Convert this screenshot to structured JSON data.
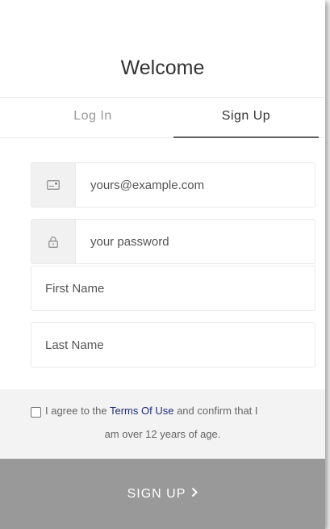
{
  "header": {
    "title": "Welcome"
  },
  "tabs": [
    {
      "label": "Log In",
      "active": false
    },
    {
      "label": "Sign Up",
      "active": true
    }
  ],
  "form": {
    "email": {
      "placeholder": "yours@example.com",
      "icon": "envelope-icon"
    },
    "password": {
      "placeholder": "your password",
      "icon": "lock-icon"
    },
    "first_name": {
      "placeholder": "First Name"
    },
    "last_name": {
      "placeholder": "Last Name"
    }
  },
  "terms": {
    "prefix": "I agree to the ",
    "link": "Terms Of Use",
    "suffix": " and confirm that I",
    "line2": "am over 12 years of age.",
    "checked": false
  },
  "submit": {
    "label": "SIGN UP",
    "icon": "chevron-right-icon"
  },
  "colors": {
    "submit_bg": "#999999",
    "terms_bg": "#f3f3f3",
    "link": "#1e2d7a",
    "active_tab_underline": "#5f5f5f"
  }
}
